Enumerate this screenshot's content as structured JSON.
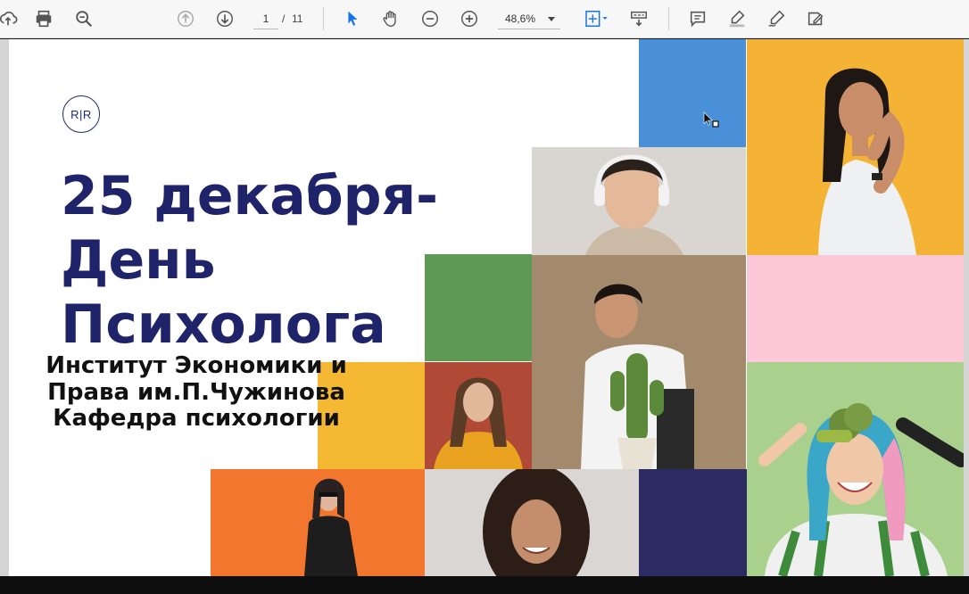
{
  "toolbar": {
    "current_page": "1",
    "page_separator": "/",
    "total_pages": "11",
    "zoom_level": "48,6%"
  },
  "slide": {
    "logo_text": "R|R",
    "title_lines": [
      "25 декабря-",
      "День",
      "Психолога"
    ],
    "subtitle_lines": [
      "Институт Экономики и",
      "Права им.П.Чужинова",
      "Кафедра психологии"
    ]
  },
  "colors": {
    "title": "#1f2369",
    "blue_tile": "#4a90d9",
    "yellow_tile": "#f5b833",
    "green_tile": "#5e9a54",
    "pink_tile": "#fdc8d8",
    "navy_tile": "#2c2b63",
    "orange_tile": "#f2762e",
    "accent_icon": "#1473e6"
  },
  "icons": [
    "upload-icon",
    "print-icon",
    "zoom-search-icon",
    "page-up-icon",
    "page-down-icon",
    "select-arrow-icon",
    "hand-tool-icon",
    "zoom-out-icon",
    "zoom-in-icon",
    "fit-page-icon",
    "scroll-mode-icon",
    "comment-icon",
    "highlight-icon",
    "draw-icon",
    "fill-sign-icon"
  ]
}
